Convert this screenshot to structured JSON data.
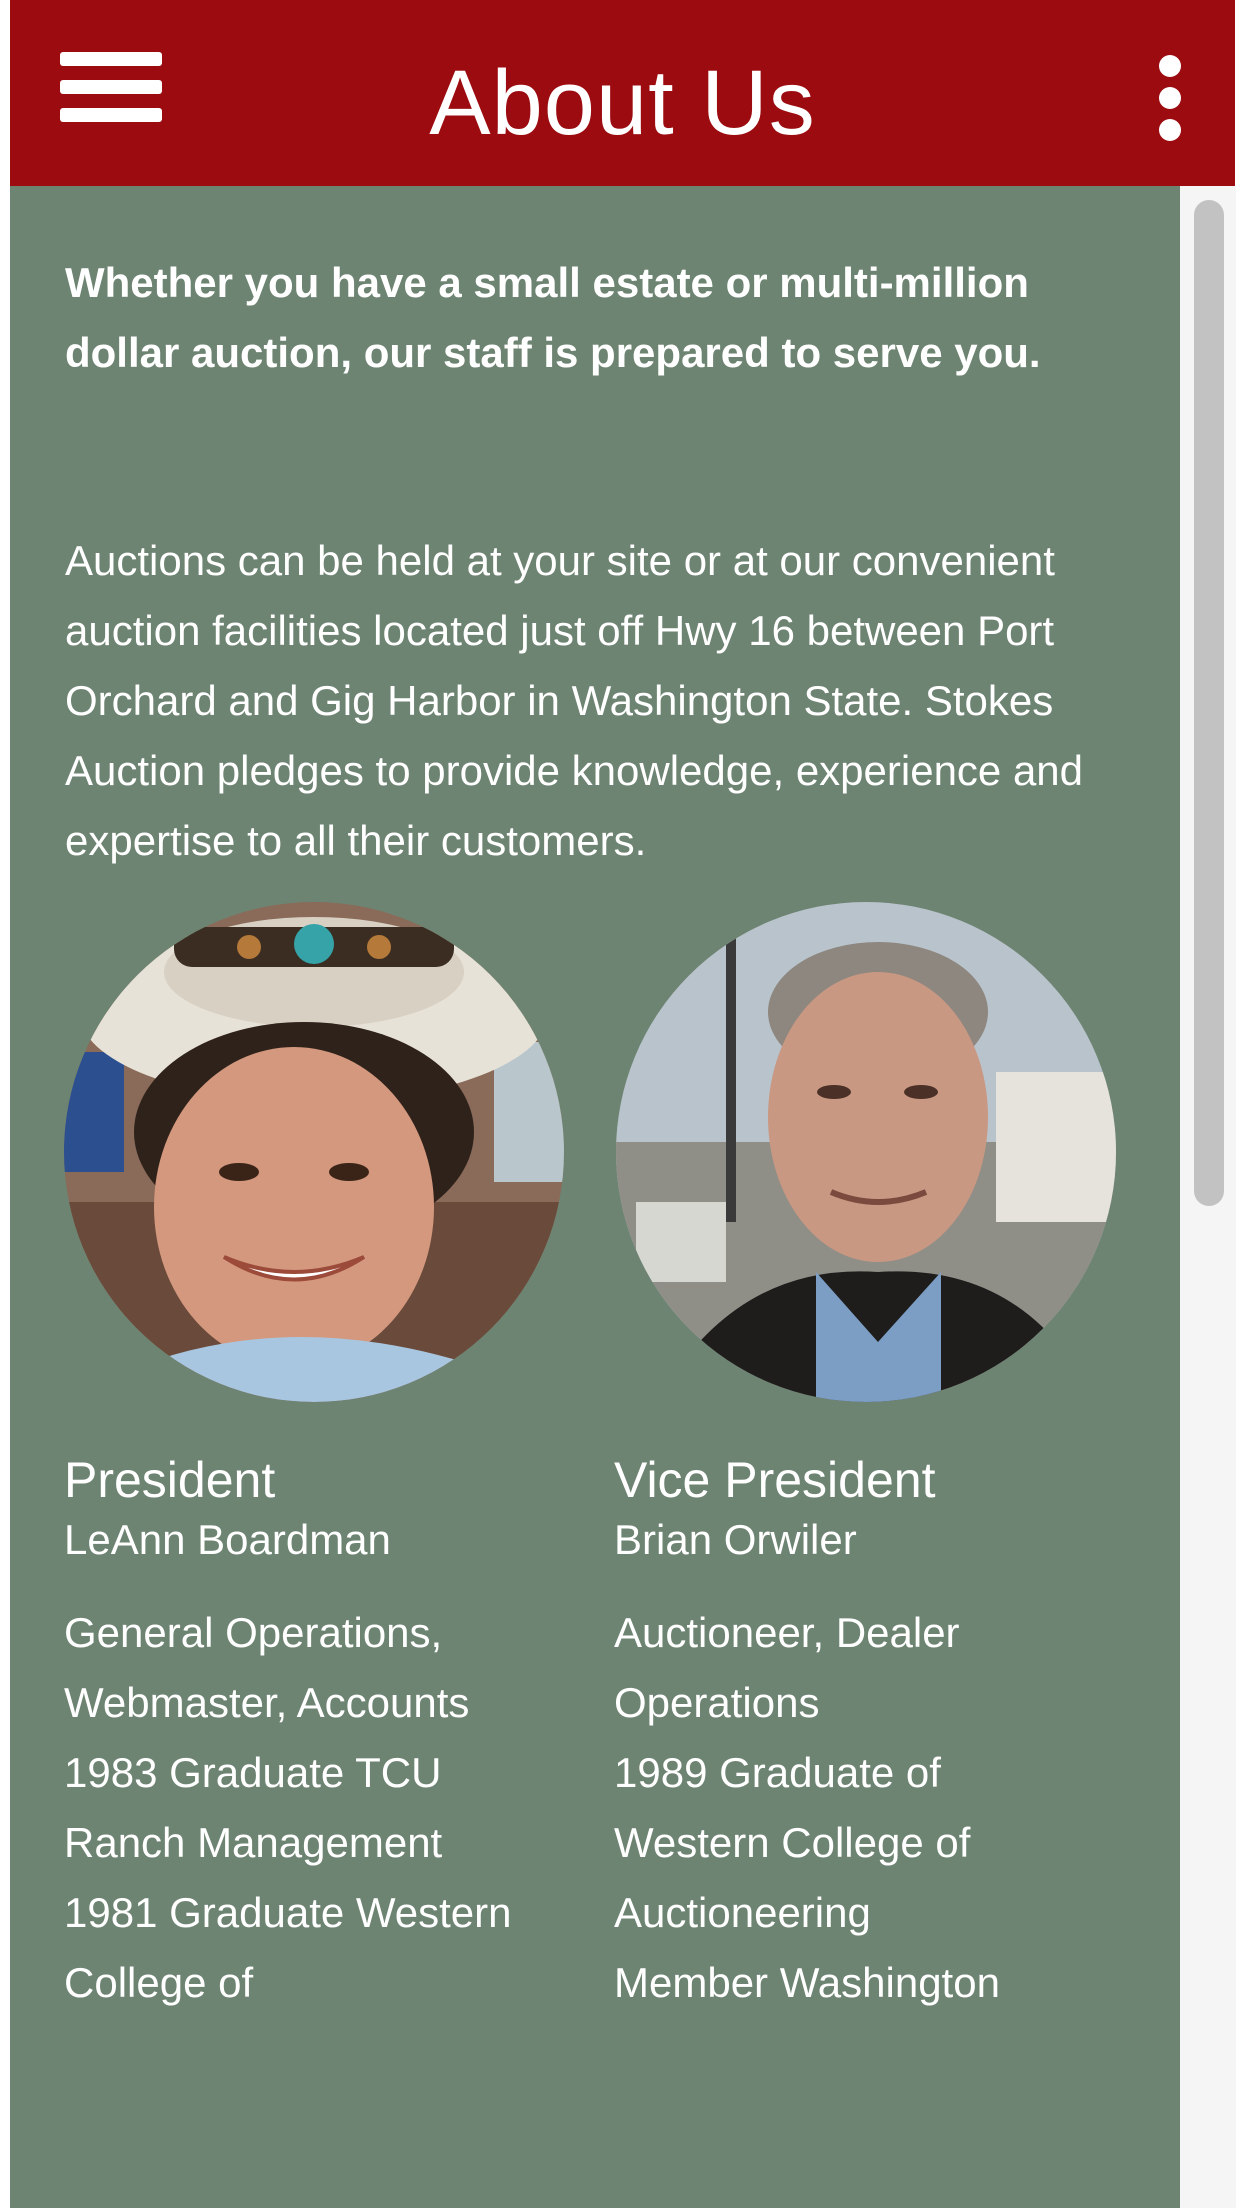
{
  "appbar": {
    "title": "About Us",
    "menu_icon": "hamburger-menu-icon",
    "overflow_icon": "more-vertical-icon",
    "color": "#9b0b0f"
  },
  "content": {
    "background": "#6e8472",
    "intro_bold": "Whether you have a small estate or multi-million dollar auction, our staff is prepared to serve you.",
    "intro_text": "Auctions can be held at your site or at our convenient auction facilities located just off Hwy 16 between Port Orchard and Gig Harbor in Washington State. Stokes Auction pledges to provide knowledge, experience and expertise to all their customers."
  },
  "staff": [
    {
      "role": "President",
      "name": "LeAnn Boardman",
      "desc_lines": [
        "General Operations,",
        "Webmaster, Accounts",
        "1983 Graduate TCU",
        "Ranch Management",
        "1981 Graduate Western",
        "College of"
      ]
    },
    {
      "role": "Vice President",
      "name": "Brian Orwiler",
      "desc_lines": [
        "Auctioneer, Dealer",
        "Operations",
        "1989 Graduate of",
        "Western College of",
        "Auctioneering",
        "Member Washington"
      ]
    }
  ]
}
